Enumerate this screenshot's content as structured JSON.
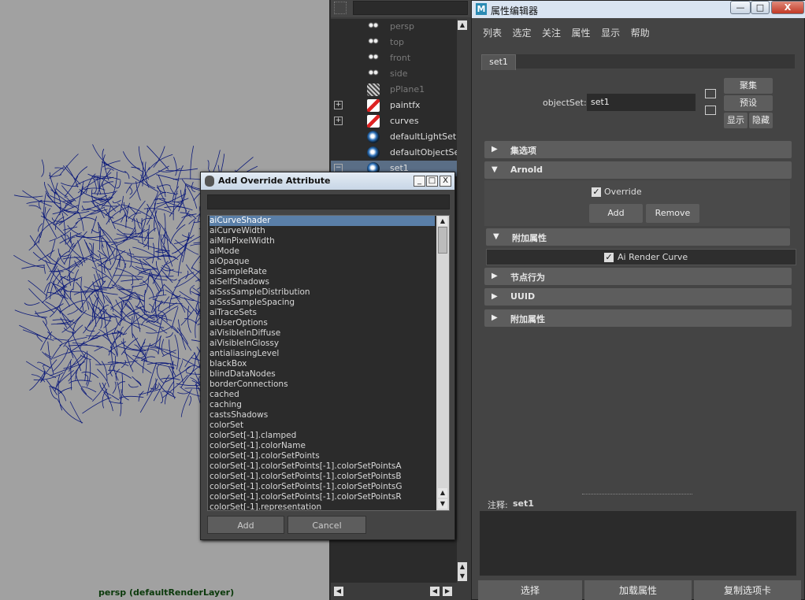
{
  "viewport": {
    "label": "persp (defaultRenderLayer)",
    "hair_color": "#0c1a7a"
  },
  "outliner": {
    "items": [
      {
        "label": "persp",
        "icon": "camera-icon"
      },
      {
        "label": "top",
        "icon": "camera-icon"
      },
      {
        "label": "front",
        "icon": "camera-icon"
      },
      {
        "label": "side",
        "icon": "camera-icon"
      },
      {
        "label": "pPlane1",
        "icon": "mesh-icon"
      },
      {
        "label": "paintfx",
        "icon": "paintfx-icon",
        "expand": "+"
      },
      {
        "label": "curves",
        "icon": "paintfx-icon",
        "expand": "+"
      },
      {
        "label": "defaultLightSet",
        "icon": "set-icon"
      },
      {
        "label": "defaultObjectSet",
        "icon": "set-icon"
      },
      {
        "label": "set1",
        "icon": "set-icon",
        "expand": "−"
      }
    ]
  },
  "attribute_editor": {
    "title": "属性编辑器",
    "logo": "M",
    "window_buttons": {
      "minimize": "—",
      "maximize": "□",
      "close": "X"
    },
    "menu": [
      "列表",
      "选定",
      "关注",
      "属性",
      "显示",
      "帮助"
    ],
    "tab": "set1",
    "object_set_label": "objectSet:",
    "object_set_value": "set1",
    "side_buttons": [
      "聚集",
      "预设",
      "显示",
      "隐藏"
    ],
    "sections": {
      "collection": "集选项",
      "arnold": "Arnold",
      "extra_attrs_inner": "附加属性",
      "node_behavior": "节点行为",
      "uuid": "UUID",
      "extra_attrs": "附加属性"
    },
    "override_label": "Override",
    "add_label": "Add",
    "remove_label": "Remove",
    "render_curve_label": "Ai Render Curve",
    "check_mark": "✓",
    "notes_label": "注释:",
    "notes_value": "set1",
    "bottom_buttons": [
      "选择",
      "加载属性",
      "复制选项卡"
    ]
  },
  "dialog": {
    "title": "Add Override Attribute",
    "window_buttons": {
      "minimize": "_",
      "maximize": "□",
      "close": "X"
    },
    "items": [
      "aiCurveShader",
      "aiCurveWidth",
      "aiMinPixelWidth",
      "aiMode",
      "aiOpaque",
      "aiSampleRate",
      "aiSelfShadows",
      "aiSssSampleDistribution",
      "aiSssSampleSpacing",
      "aiTraceSets",
      "aiUserOptions",
      "aiVisibleInDiffuse",
      "aiVisibleInGlossy",
      "antialiasingLevel",
      "blackBox",
      "blindDataNodes",
      "borderConnections",
      "cached",
      "caching",
      "castsShadows",
      "colorSet",
      "colorSet[-1].clamped",
      "colorSet[-1].colorName",
      "colorSet[-1].colorSetPoints",
      "colorSet[-1].colorSetPoints[-1].colorSetPointsA",
      "colorSet[-1].colorSetPoints[-1].colorSetPointsB",
      "colorSet[-1].colorSetPoints[-1].colorSetPointsG",
      "colorSet[-1].colorSetPoints[-1].colorSetPointsR",
      "colorSet[-1].representation"
    ],
    "selected_index": 0,
    "add_label": "Add",
    "cancel_label": "Cancel"
  }
}
